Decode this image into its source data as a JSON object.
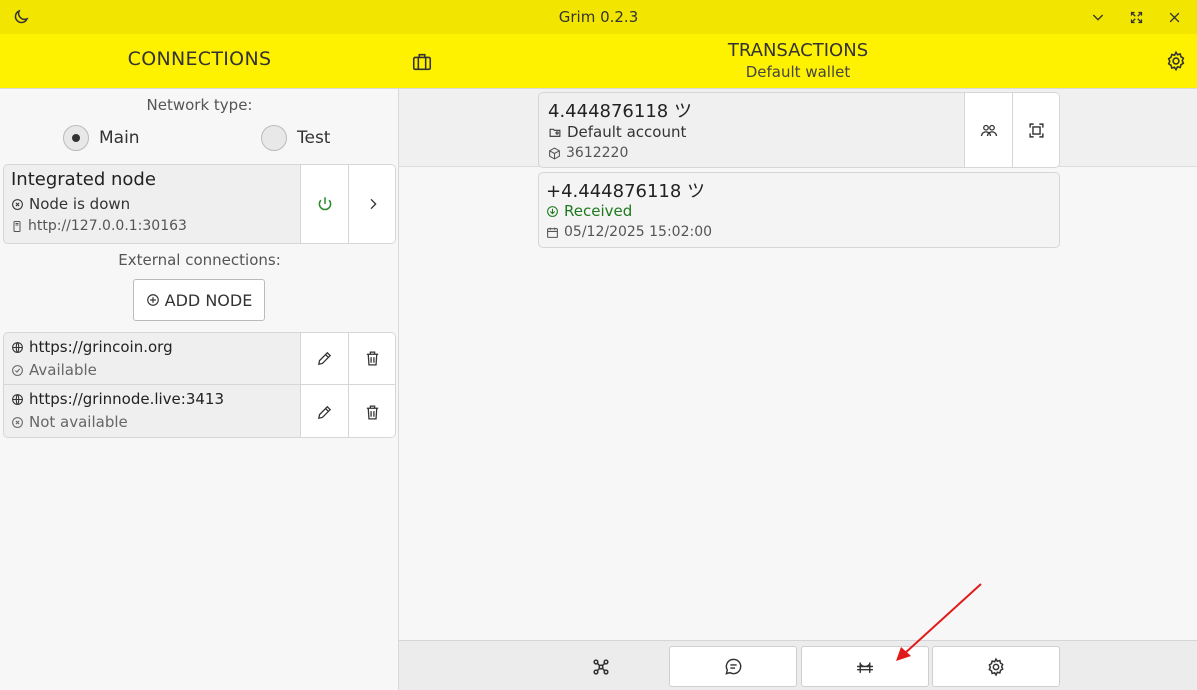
{
  "window": {
    "title": "Grim 0.2.3"
  },
  "header": {
    "connections_title": "CONNECTIONS",
    "transactions_title": "TRANSACTIONS",
    "wallet_name": "Default wallet"
  },
  "connections": {
    "network_type_label": "Network type:",
    "network_options": [
      {
        "label": "Main",
        "selected": true
      },
      {
        "label": "Test",
        "selected": false
      }
    ],
    "integrated_node": {
      "title": "Integrated node",
      "status": "Node is down",
      "address": "http://127.0.0.1:30163"
    },
    "external_label": "External connections:",
    "add_node_label": "ADD NODE",
    "external_nodes": [
      {
        "url": "https://grincoin.org",
        "status": "Available"
      },
      {
        "url": "https://grinnode.live:3413",
        "status": "Not available"
      }
    ]
  },
  "account": {
    "balance": "4.444876118 ツ",
    "name": "Default account",
    "height": "3612220"
  },
  "transactions": [
    {
      "amount": "+4.444876118 ツ",
      "status": "Received",
      "datetime": "05/12/2025 15:02:00"
    }
  ],
  "colors": {
    "header_yellow": "#fff200",
    "titlebar_yellow": "#f2e600",
    "received_green": "#1e7a1e",
    "power_green": "#2a8a2a",
    "annotation_red": "#e01b1b"
  }
}
